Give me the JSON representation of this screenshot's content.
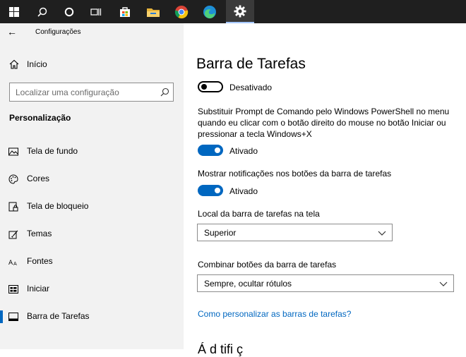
{
  "taskbar": {
    "icons": [
      "windows-start-icon",
      "search-icon",
      "cortana-icon",
      "task-view-icon",
      "store-icon",
      "file-explorer-icon",
      "chrome-icon",
      "edge-icon",
      "settings-icon"
    ],
    "accent": "#a6c8ff",
    "pointer_color": "#e81123"
  },
  "sidebar": {
    "header_title": "Configurações",
    "home_label": "Início",
    "search_placeholder": "Localizar uma configuração",
    "section_title": "Personalização",
    "items": [
      {
        "label": "Tela de fundo",
        "icon": "picture-icon"
      },
      {
        "label": "Cores",
        "icon": "palette-icon"
      },
      {
        "label": "Tela de bloqueio",
        "icon": "lock-screen-icon"
      },
      {
        "label": "Temas",
        "icon": "brush-icon"
      },
      {
        "label": "Fontes",
        "icon": "font-icon"
      },
      {
        "label": "Iniciar",
        "icon": "start-icon"
      },
      {
        "label": "Barra de Tarefas",
        "icon": "taskbar-icon"
      }
    ],
    "selected_index": 6
  },
  "main": {
    "title": "Barra de Tarefas",
    "toggle1_state": "Desativado",
    "setting2_desc": "Substituir Prompt de Comando pelo Windows PowerShell no menu quando eu clicar com o botão direito do mouse no botão Iniciar ou pressionar a tecla Windows+X",
    "toggle2_state": "Ativado",
    "setting3_desc": "Mostrar notificações nos botões da barra de tarefas",
    "toggle3_state": "Ativado",
    "location_label": "Local da barra de tarefas na tela",
    "location_value": "Superior",
    "combine_label": "Combinar botões da barra de tarefas",
    "combine_value": "Sempre, ocultar rótulos",
    "help_link": "Como personalizar as barras de tarefas?",
    "next_section_partial": "Á  d   tifi  ç"
  },
  "colors": {
    "accent": "#0067c0"
  }
}
